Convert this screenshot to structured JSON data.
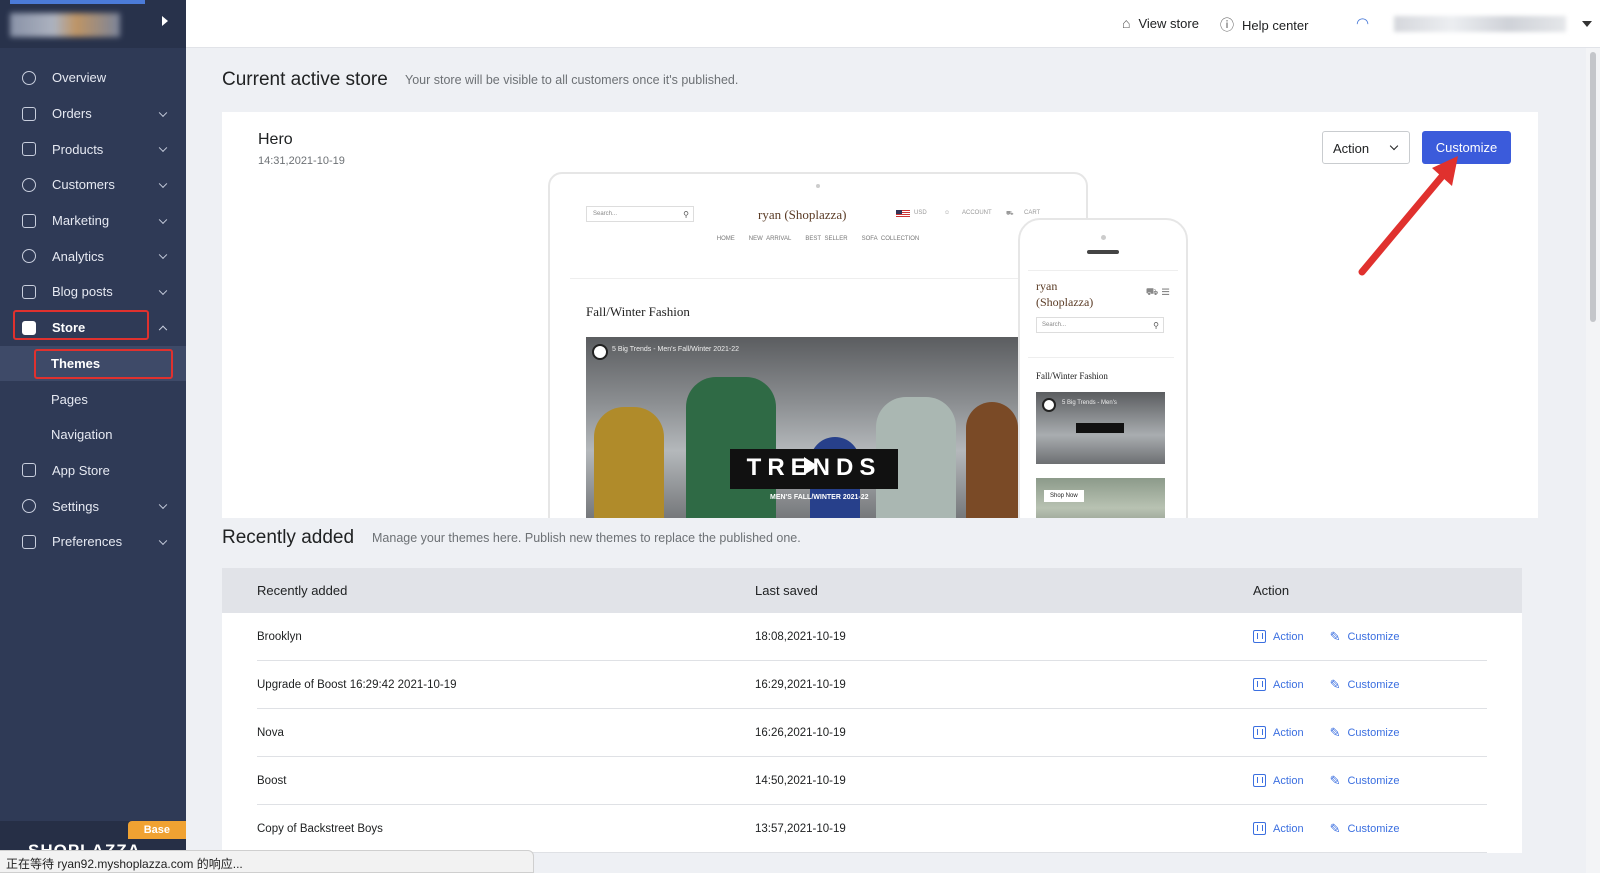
{
  "sidebar": {
    "items": [
      {
        "label": "Overview",
        "icon": "overview-icon",
        "expandable": false
      },
      {
        "label": "Orders",
        "icon": "orders-icon",
        "expandable": true
      },
      {
        "label": "Products",
        "icon": "products-icon",
        "expandable": true
      },
      {
        "label": "Customers",
        "icon": "customers-icon",
        "expandable": true
      },
      {
        "label": "Marketing",
        "icon": "marketing-icon",
        "expandable": true
      },
      {
        "label": "Analytics",
        "icon": "analytics-icon",
        "expandable": true
      },
      {
        "label": "Blog posts",
        "icon": "blog-icon",
        "expandable": true
      },
      {
        "label": "Store",
        "icon": "store-icon",
        "expandable": true
      },
      {
        "label": "App Store",
        "icon": "app-store-icon",
        "expandable": false
      },
      {
        "label": "Settings",
        "icon": "settings-icon",
        "expandable": true
      },
      {
        "label": "Preferences",
        "icon": "preferences-icon",
        "expandable": true
      }
    ],
    "store_sub": [
      "Themes",
      "Pages",
      "Navigation"
    ],
    "active": "Themes",
    "badge": "Base",
    "brand": "SHOPLAZZA"
  },
  "topbar": {
    "view_store": "View store",
    "help_center": "Help center"
  },
  "current": {
    "title": "Current active store",
    "subtitle": "Your store will be visible to all customers once it's published.",
    "theme_name": "Hero",
    "theme_time": "14:31,2021-10-19",
    "action_label": "Action",
    "customize_label": "Customize",
    "preview": {
      "search_placeholder": "Search...",
      "brand": "ryan (Shoplazza)",
      "currency": "USD",
      "account": "ACCOUNT",
      "cart": "CART",
      "nav": [
        "HOME",
        "NEW ARRIVAL",
        "BEST SELLER",
        "SOFA COLLECTION"
      ],
      "heading": "Fall/Winter Fashion",
      "video_title": "5 Big Trends - Men's Fall/Winter 2021-22",
      "trends_text": "TRENDS",
      "trends_sub": "MEN'S FALL/WINTER 2021-22",
      "mobile_brand_1": "ryan",
      "mobile_brand_2": "(Shoplazza)",
      "mobile_video_title": "5 Big Trends - Men's",
      "shop_now": "Shop Now"
    }
  },
  "recent": {
    "title": "Recently added",
    "subtitle": "Manage your themes here. Publish new themes to replace the published one.",
    "columns": [
      "Recently added",
      "Last saved",
      "Action"
    ],
    "action_link": "Action",
    "customize_link": "Customize",
    "rows": [
      {
        "name": "Brooklyn",
        "saved": "18:08,2021-10-19"
      },
      {
        "name": "Upgrade of Boost 16:29:42 2021-10-19",
        "saved": "16:29,2021-10-19"
      },
      {
        "name": "Nova",
        "saved": "16:26,2021-10-19"
      },
      {
        "name": "Boost",
        "saved": "14:50,2021-10-19"
      },
      {
        "name": "Copy of Backstreet Boys",
        "saved": "13:57,2021-10-19"
      }
    ]
  },
  "status_bar": "正在等待 ryan92.myshoplazza.com 的响应...",
  "colors": {
    "sidebar": "#2f3a56",
    "primary_button": "#3b5bdb",
    "link": "#3b6fe0",
    "highlight_red": "#e0312e"
  }
}
